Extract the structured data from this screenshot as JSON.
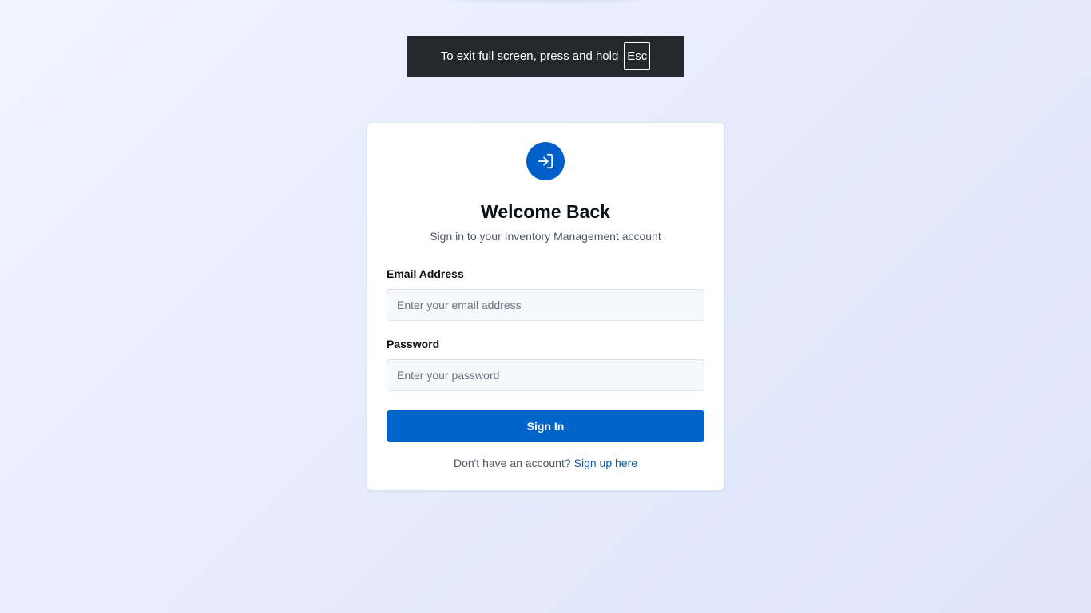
{
  "fullscreen_banner": {
    "message": "To exit full screen, press and hold",
    "key": "Esc"
  },
  "login": {
    "icon": "login-arrow-icon",
    "title": "Welcome Back",
    "subtitle": "Sign in to your Inventory Management account",
    "email": {
      "label": "Email Address",
      "value": "",
      "placeholder": "Enter your email address"
    },
    "password": {
      "label": "Password",
      "value": "",
      "placeholder": "Enter your password"
    },
    "submit_label": "Sign In",
    "signup_prompt": "Don't have an account?",
    "signup_link": "Sign up here"
  },
  "colors": {
    "primary": "#0064c8",
    "link": "#0a5aa8",
    "banner_bg": "#24272e"
  }
}
